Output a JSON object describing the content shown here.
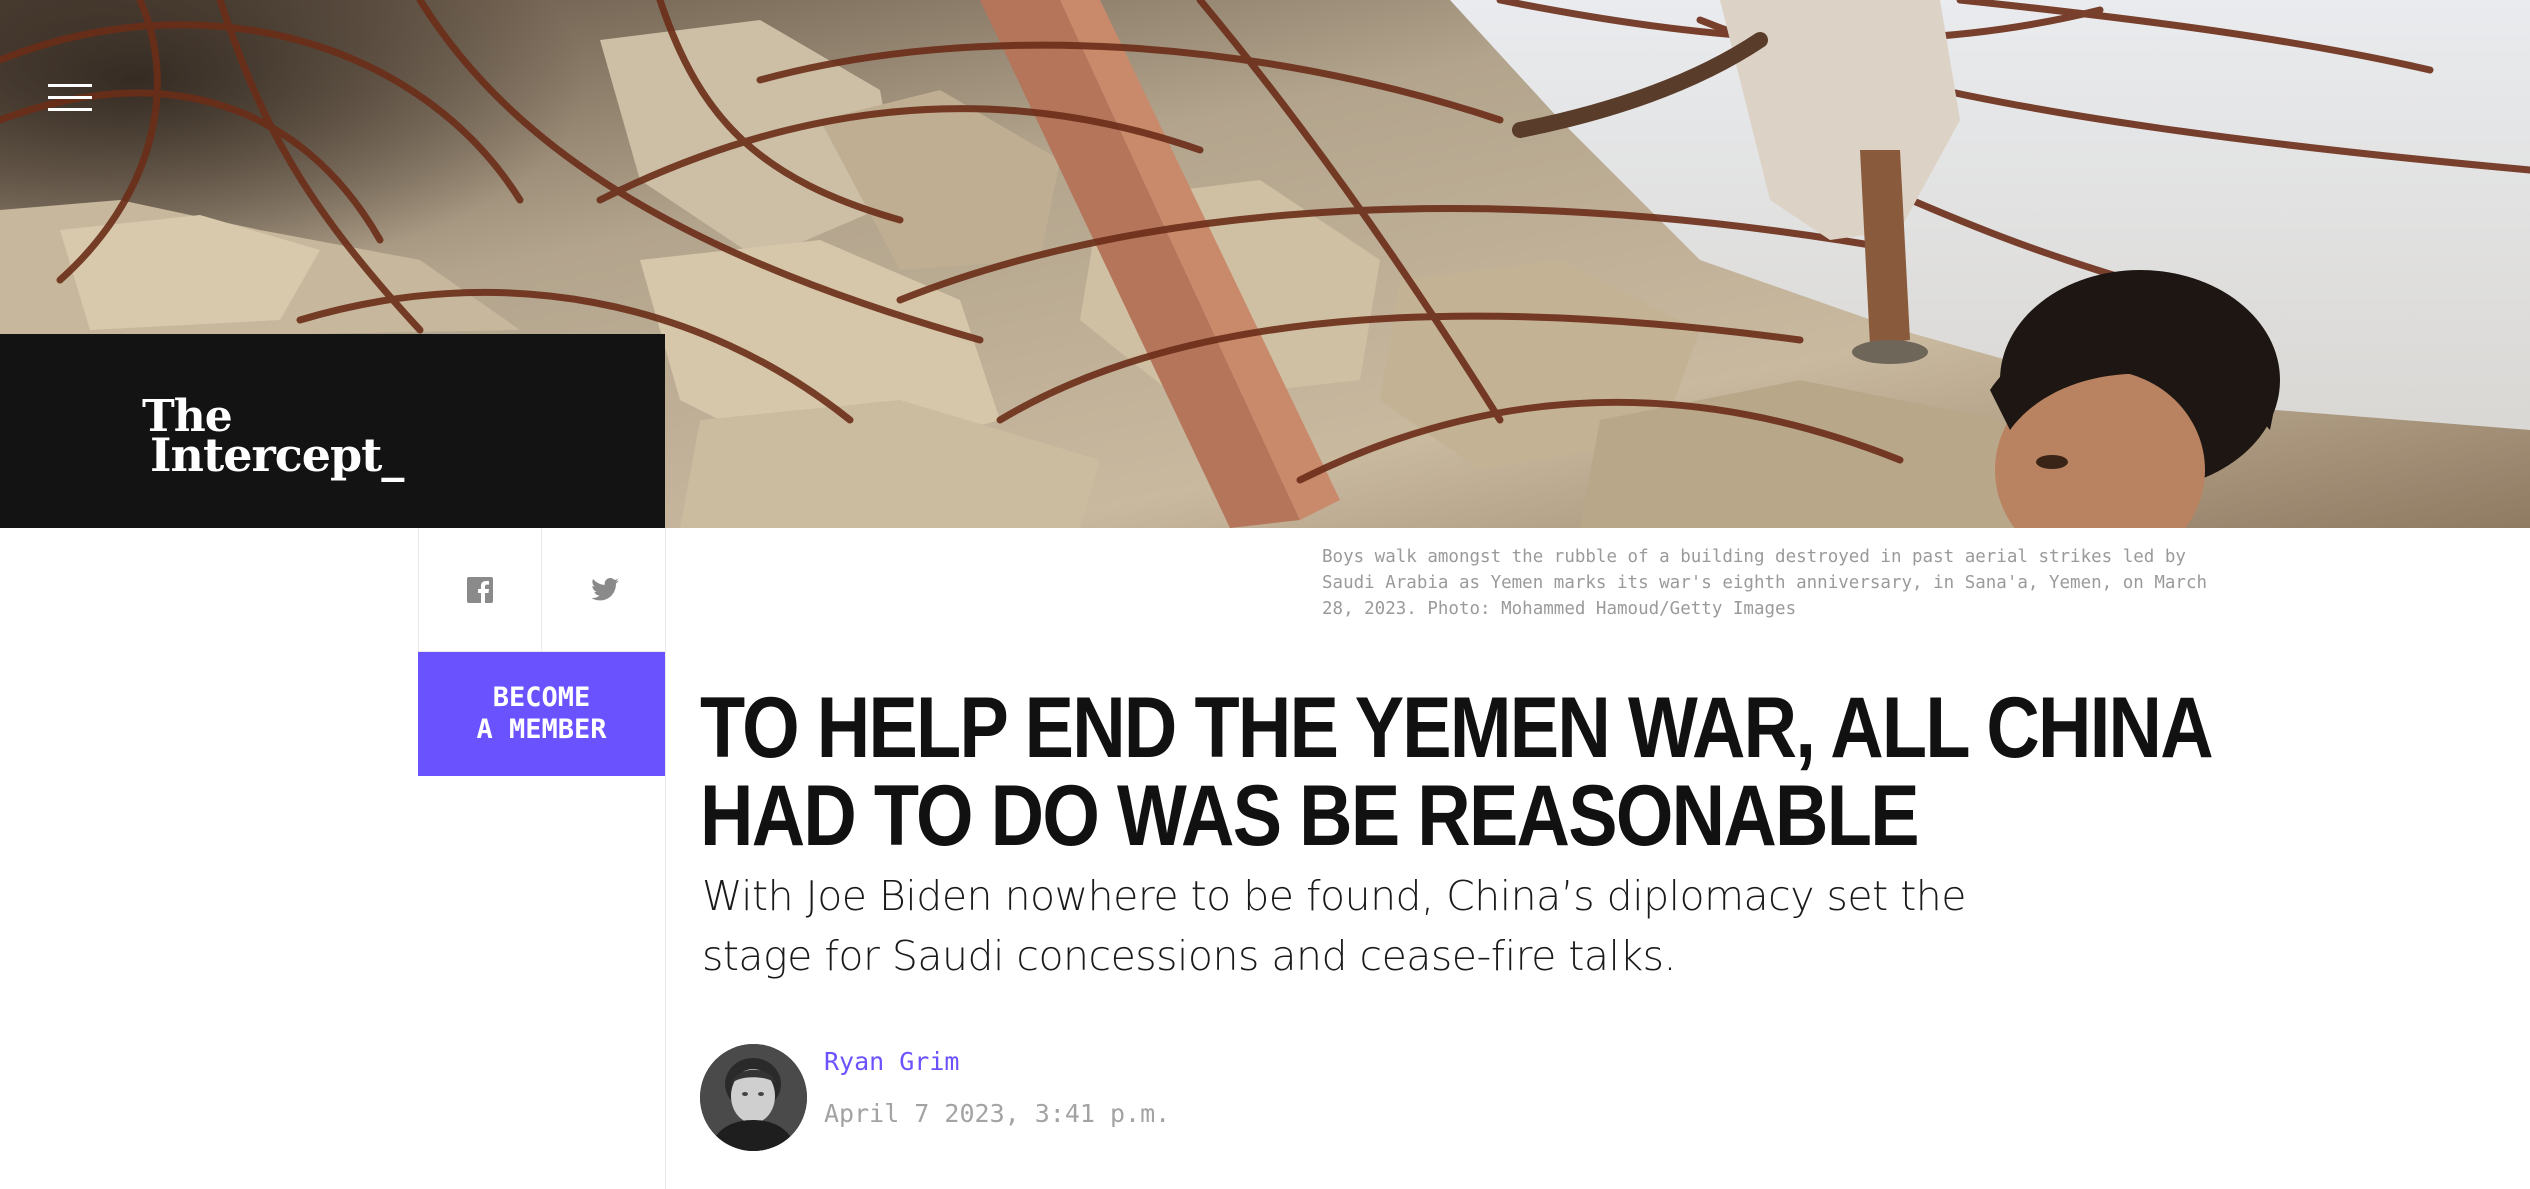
{
  "site": {
    "logo_line1": "The",
    "logo_line2": "Intercept_"
  },
  "nav": {
    "menu_icon": "hamburger-menu-icon"
  },
  "share": {
    "facebook_icon": "facebook-icon",
    "twitter_icon": "twitter-icon"
  },
  "membership": {
    "line1": "BECOME",
    "line2": "A MEMBER"
  },
  "article": {
    "caption": "Boys walk amongst the rubble of a building destroyed in past aerial strikes led by Saudi Arabia as Yemen marks its war's eighth anniversary, in Sana'a, Yemen, on March 28, 2023. Photo: Mohammed Hamoud/Getty Images",
    "headline_line1": "TO HELP END THE YEMEN WAR, ALL CHINA",
    "headline_line2": "HAD TO DO WAS BE REASONABLE",
    "dek_line1": "With Joe Biden nowhere to be found, China’s diplomacy set the",
    "dek_line2": "stage for Saudi concessions and cease-fire talks.",
    "author": "Ryan Grim",
    "date": "April 7 2023, 3:41 p.m."
  },
  "colors": {
    "accent": "#6a52ff",
    "logo_bg": "#131313",
    "headline": "#111111",
    "caption": "#9a9a9a"
  }
}
